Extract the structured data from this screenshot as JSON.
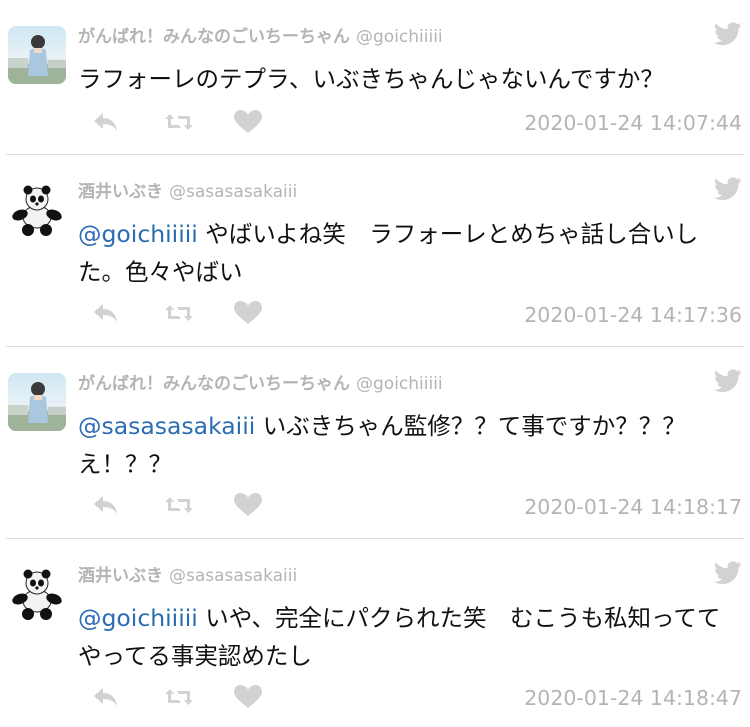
{
  "tweets": [
    {
      "avatar": "photo-avatar",
      "name": "がんばれ！みんなのごいちーちゃん",
      "handle": "@goichiiiii",
      "mention": "",
      "text": "ラフォーレのテプラ、いぶきちゃんじゃないんですか？",
      "timestamp": "2020-01-24 14:07:44"
    },
    {
      "avatar": "panda-avatar",
      "name": "酒井いぶき",
      "handle": "@sasasasakaiii",
      "mention": "@goichiiiii",
      "text": " やばいよね笑　ラフォーレとめちゃ話し合いした。色々やばい",
      "timestamp": "2020-01-24 14:17:36"
    },
    {
      "avatar": "photo-avatar",
      "name": "がんばれ！みんなのごいちーちゃん",
      "handle": "@goichiiiii",
      "mention": "@sasasasakaiii",
      "text": " いぶきちゃん監修？？て事ですか？？？え！？？",
      "timestamp": "2020-01-24 14:18:17"
    },
    {
      "avatar": "panda-avatar",
      "name": "酒井いぶき",
      "handle": "@sasasasakaiii",
      "mention": "@goichiiiii",
      "text": " いや、完全にパクられた笑　むこうも私知っててやってる事実認めたし",
      "timestamp": "2020-01-24 14:18:47"
    }
  ],
  "colors": {
    "mention": "#2b6cb3",
    "meta_gray": "#b4b4b4",
    "icon_gray": "#d2d2d2",
    "divider": "#dcdcdc"
  },
  "icons": [
    "twitter-bird-icon",
    "reply-icon",
    "retweet-icon",
    "like-heart-icon"
  ]
}
